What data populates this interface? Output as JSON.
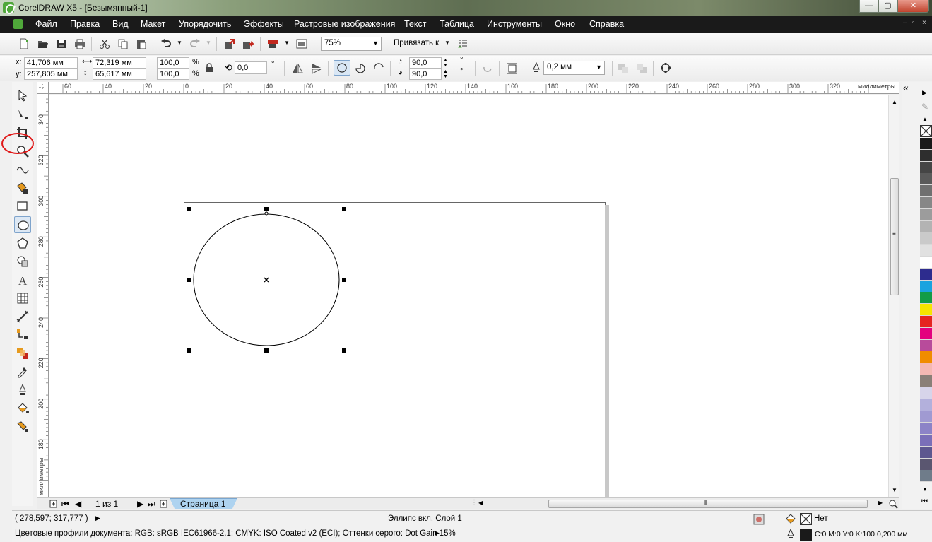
{
  "window": {
    "title": "CorelDRAW X5 - [Безымянный-1]",
    "minimize": "—",
    "maximize": "▢",
    "close": "✕"
  },
  "menu": {
    "items": [
      "Файл",
      "Правка",
      "Вид",
      "Макет",
      "Упорядочить",
      "Эффекты",
      "Растровые изображения",
      "Текст",
      "Таблица",
      "Инструменты",
      "Окно",
      "Справка"
    ],
    "doc_controls": [
      "–",
      "▫",
      "×"
    ]
  },
  "toolbar": {
    "zoom_value": "75%",
    "snap_label": "Привязать к",
    "icons": [
      "new-icon",
      "open-icon",
      "save-icon",
      "print-icon",
      "cut-icon",
      "copy-icon",
      "paste-icon",
      "undo-icon",
      "redo-icon",
      "import-icon",
      "export-icon",
      "application-launcher-icon",
      "welcome-screen-icon",
      "snap-options-icon"
    ]
  },
  "propbar": {
    "x_label": "x:",
    "x_value": "41,706 мм",
    "y_label": "y:",
    "y_value": "257,805 мм",
    "width_value": "72,319 мм",
    "height_value": "65,617 мм",
    "scale_x": "100,0",
    "scale_y": "100,0",
    "percent_x": "%",
    "percent_y": "%",
    "rotation": "0,0",
    "degree": "°",
    "start_angle": "90,0",
    "end_angle": "90,0",
    "deg_start": "°",
    "deg_end": "°",
    "outline_width": "0,2 мм"
  },
  "rulers": {
    "unit_label": "миллиметры",
    "top_ticks": [
      "60",
      "40",
      "20",
      "0",
      "20",
      "40",
      "60",
      "80",
      "100",
      "120",
      "140",
      "160",
      "180",
      "200",
      "220",
      "240",
      "260",
      "280",
      "300",
      "320"
    ],
    "left_ticks": [
      "340",
      "320",
      "300",
      "280",
      "260",
      "240",
      "220",
      "200",
      "180"
    ],
    "left_unit": "миллиметры"
  },
  "pagenav": {
    "page_counter": "1 из 1",
    "page_tab": "Страница 1"
  },
  "status": {
    "coords": "( 278,597; 317,777 )",
    "object_info": "Эллипс вкл. Слой 1",
    "color_profiles": "Цветовые профили документа: RGB: sRGB IEC61966-2.1; CMYK: ISO Coated v2 (ECI); Оттенки серого: Dot Gain 15%",
    "fill_none": "Нет",
    "outline_info": "C:0 M:0 Y:0 K:100  0,200 мм"
  },
  "palette_colors": [
    "#1a1a1a",
    "#2e2e2e",
    "#454545",
    "#5a5a5a",
    "#707070",
    "#878787",
    "#9c9c9c",
    "#b3b3b3",
    "#cacaca",
    "#e1e1e1",
    "#ffffff",
    "#2d2c8e",
    "#1aa3df",
    "#129c48",
    "#f6e500",
    "#e52420",
    "#e3007e",
    "#b84b9b",
    "#f08c00",
    "#f4b8b3",
    "#8a7f78",
    "#d7d4ea",
    "#b3b0dc",
    "#a09ad2",
    "#8c83c7",
    "#7a6fb8",
    "#5d578f",
    "#5a5670",
    "#6f7c8a"
  ]
}
